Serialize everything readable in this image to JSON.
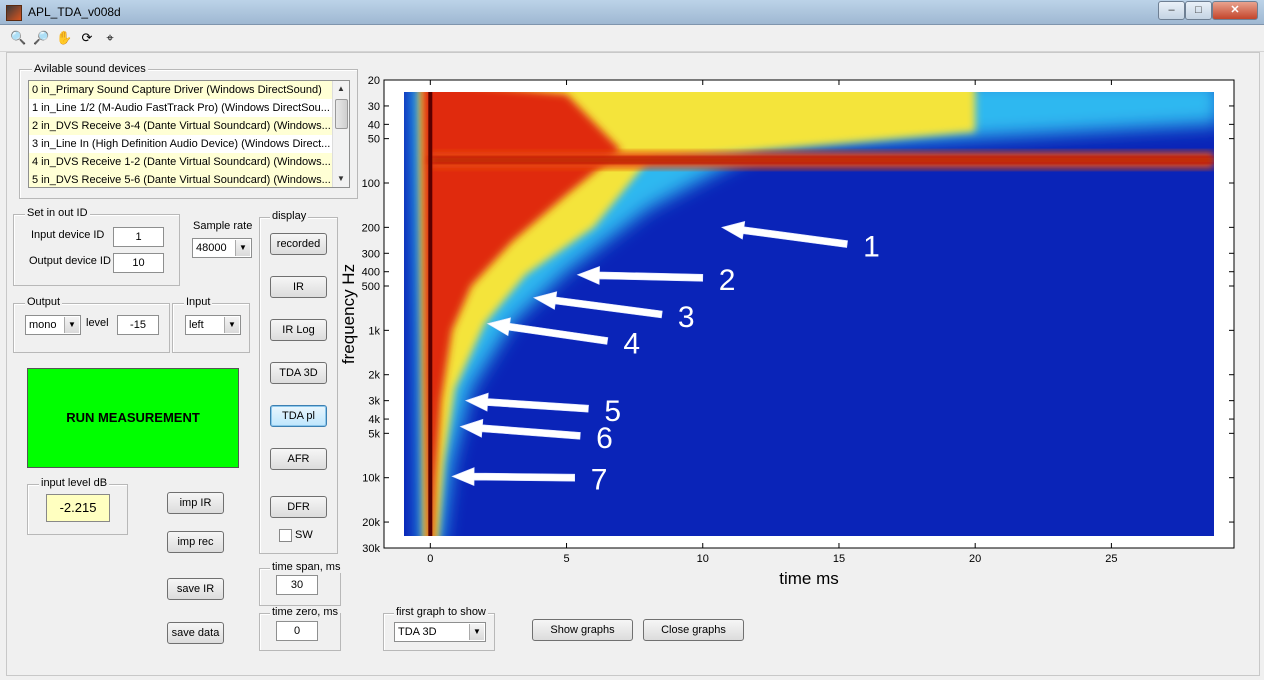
{
  "window": {
    "title": "APL_TDA_v008d",
    "minimize": "–",
    "maximize": "□",
    "close": "✕"
  },
  "toolbar": {
    "icons": [
      "zoom-in-icon",
      "zoom-out-icon",
      "pan-hand-icon",
      "rotate-3d-icon",
      "data-cursor-icon"
    ]
  },
  "devices": {
    "legend": "Avilable sound devices",
    "items": [
      "0 in_Primary Sound Capture Driver (Windows DirectSound)",
      "1 in_Line 1/2 (M-Audio FastTrack Pro) (Windows DirectSou...",
      "2 in_DVS Receive 3-4 (Dante Virtual Soundcard) (Windows...",
      "3 in_Line In (High Definition Audio Device) (Windows Direct...",
      "4 in_DVS Receive 1-2 (Dante Virtual Soundcard) (Windows...",
      "5 in_DVS Receive 5-6 (Dante Virtual Soundcard) (Windows..."
    ],
    "selected": [
      0,
      2,
      4,
      5
    ]
  },
  "io_id": {
    "legend": "Set in out ID",
    "input_label": "Input device ID",
    "input_value": "1",
    "output_label": "Output device ID",
    "output_value": "10"
  },
  "sample_rate": {
    "label": "Sample rate",
    "value": "48000"
  },
  "output": {
    "legend": "Output",
    "mode": "mono",
    "level_label": "level",
    "level_value": "-15"
  },
  "input": {
    "legend": "Input",
    "channel": "left"
  },
  "run_button": "RUN MEASUREMENT",
  "input_level": {
    "legend": "input level dB",
    "value": "-2.215"
  },
  "side_buttons": {
    "imp_ir": "imp IR",
    "imp_rec": "imp rec",
    "save_ir": "save IR",
    "save_data": "save data"
  },
  "display": {
    "legend": "display",
    "buttons": [
      "recorded",
      "IR",
      "IR Log",
      "TDA 3D",
      "TDA pl",
      "AFR",
      "DFR"
    ],
    "focused": "TDA pl",
    "sw_label": "SW"
  },
  "time_span": {
    "legend": "time span, ms",
    "value": "30"
  },
  "time_zero": {
    "legend": "time zero, ms",
    "value": "0"
  },
  "first_graph": {
    "legend": "first graph to show",
    "value": "TDA 3D"
  },
  "graph_buttons": {
    "show": "Show graphs",
    "close": "Close graphs"
  },
  "chart_data": {
    "type": "heatmap",
    "xlabel": "time   ms",
    "ylabel": "frequency   Hz",
    "x_ticks": [
      0,
      5,
      10,
      15,
      20,
      25
    ],
    "xlim": [
      -1.7,
      29.5
    ],
    "y_scale": "log",
    "ylim": [
      20,
      30000
    ],
    "y_ticks": [
      20,
      30,
      40,
      50,
      100,
      200,
      300,
      400,
      500,
      1000,
      2000,
      3000,
      4000,
      5000,
      10000,
      20000,
      30000
    ],
    "y_tick_labels": [
      "20",
      "30",
      "40",
      "50",
      "100",
      "200",
      "300",
      "400",
      "500",
      "1k",
      "2k",
      "3k",
      "4k",
      "5k",
      "10k",
      "20k",
      "30k"
    ],
    "colormap": "jet",
    "persistent_band_hz": 70,
    "annotations": [
      {
        "label": "1",
        "tail": [
          15.3,
          260
        ],
        "head": [
          10.7,
          200
        ]
      },
      {
        "label": "2",
        "tail": [
          10.0,
          440
        ],
        "head": [
          5.4,
          420
        ]
      },
      {
        "label": "3",
        "tail": [
          8.5,
          780
        ],
        "head": [
          3.8,
          600
        ]
      },
      {
        "label": "4",
        "tail": [
          6.5,
          1180
        ],
        "head": [
          2.1,
          900
        ]
      },
      {
        "label": "5",
        "tail": [
          5.8,
          3400
        ],
        "head": [
          1.3,
          3000
        ]
      },
      {
        "label": "6",
        "tail": [
          5.5,
          5200
        ],
        "head": [
          1.1,
          4500
        ]
      },
      {
        "label": "7",
        "tail": [
          5.3,
          10000
        ],
        "head": [
          0.8,
          9800
        ]
      }
    ]
  }
}
